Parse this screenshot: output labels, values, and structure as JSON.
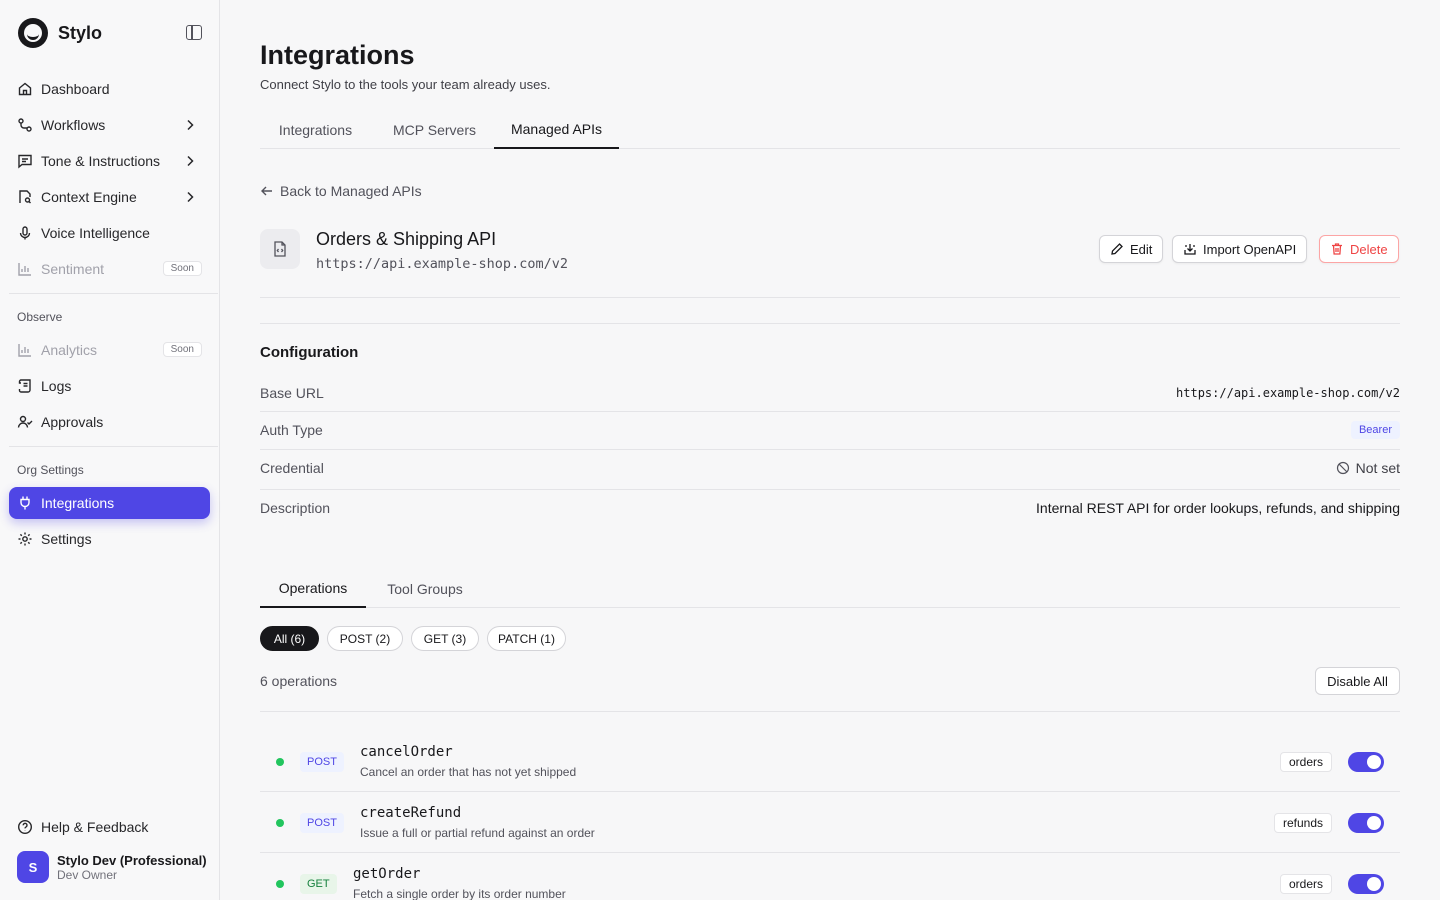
{
  "brand": {
    "name": "Stylo"
  },
  "nav": {
    "dashboard": "Dashboard",
    "workflows": "Workflows",
    "tone": "Tone & Instructions",
    "context": "Context Engine",
    "voice": "Voice Intelligence",
    "sentiment": "Sentiment",
    "observe_label": "Observe",
    "analytics": "Analytics",
    "logs": "Logs",
    "approvals": "Approvals",
    "org_label": "Org Settings",
    "integrations": "Integrations",
    "settings": "Settings",
    "soon": "Soon",
    "help": "Help & Feedback"
  },
  "user": {
    "initial": "S",
    "name": "Stylo Dev (Professional)",
    "role": "Dev Owner"
  },
  "page": {
    "title": "Integrations",
    "subtitle": "Connect Stylo to the tools your team already uses.",
    "tabs": [
      "Integrations",
      "MCP Servers",
      "Managed APIs"
    ],
    "back": "Back to Managed APIs"
  },
  "api": {
    "name": "Orders & Shipping API",
    "url": "https://api.example-shop.com/v2",
    "edit": "Edit",
    "import": "Import OpenAPI",
    "delete": "Delete"
  },
  "config": {
    "title": "Configuration",
    "base_url_label": "Base URL",
    "base_url": "https://api.example-shop.com/v2",
    "auth_label": "Auth Type",
    "auth": "Bearer",
    "credential_label": "Credential",
    "credential": "Not set",
    "description_label": "Description",
    "description": "Internal REST API for order lookups, refunds, and shipping"
  },
  "subtabs": [
    "Operations",
    "Tool Groups"
  ],
  "filters": [
    "All (6)",
    "POST (2)",
    "GET (3)",
    "PATCH (1)"
  ],
  "ops_count": "6 operations",
  "disable_all": "Disable All",
  "operations": [
    {
      "method": "POST",
      "name": "cancelOrder",
      "desc": "Cancel an order that has not yet shipped",
      "tag": "orders",
      "enabled": true
    },
    {
      "method": "POST",
      "name": "createRefund",
      "desc": "Issue a full or partial refund against an order",
      "tag": "refunds",
      "enabled": true
    },
    {
      "method": "GET",
      "name": "getOrder",
      "desc": "Fetch a single order by its order number",
      "tag": "orders",
      "enabled": true
    }
  ],
  "colors": {
    "accent": "#4f46e5",
    "success": "#22c55e",
    "danger": "#ef4444"
  }
}
